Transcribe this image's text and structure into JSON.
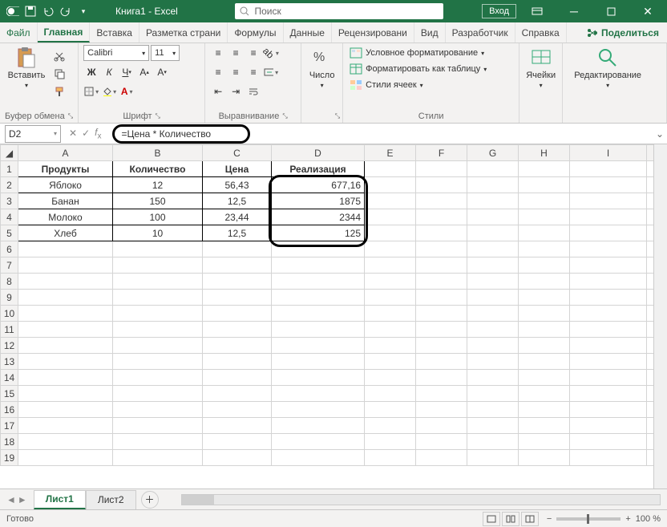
{
  "titlebar": {
    "title": "Книга1 - Excel",
    "search_placeholder": "Поиск",
    "login": "Вход"
  },
  "tabs": {
    "file": "Файл",
    "home": "Главная",
    "insert": "Вставка",
    "layout": "Разметка страни",
    "formulas": "Формулы",
    "data": "Данные",
    "review": "Рецензировани",
    "view": "Вид",
    "developer": "Разработчик",
    "help": "Справка",
    "share": "Поделиться"
  },
  "ribbon": {
    "clipboard": {
      "paste": "Вставить",
      "label": "Буфер обмена"
    },
    "font": {
      "name": "Calibri",
      "size": "11",
      "label": "Шрифт"
    },
    "alignment": {
      "label": "Выравнивание"
    },
    "number": {
      "name": "Число",
      "label": "Число"
    },
    "styles": {
      "cond": "Условное форматирование",
      "table": "Форматировать как таблицу",
      "cell": "Стили ячеек",
      "label": "Стили"
    },
    "cells": {
      "name": "Ячейки",
      "label": "Ячейки"
    },
    "editing": {
      "name": "Редактирование",
      "label": "Редактирование"
    }
  },
  "formula_bar": {
    "cell_ref": "D2",
    "formula": "=Цена * Количество"
  },
  "columns": [
    "A",
    "B",
    "C",
    "D",
    "E",
    "F",
    "G",
    "H",
    "I"
  ],
  "sheet": {
    "headers": {
      "A": "Продукты",
      "B": "Количество",
      "C": "Цена",
      "D": "Реализация"
    },
    "rows": [
      {
        "A": "Яблоко",
        "B": "12",
        "C": "56,43",
        "D": "677,16"
      },
      {
        "A": "Банан",
        "B": "150",
        "C": "12,5",
        "D": "1875"
      },
      {
        "A": "Молоко",
        "B": "100",
        "C": "23,44",
        "D": "2344"
      },
      {
        "A": "Хлеб",
        "B": "10",
        "C": "12,5",
        "D": "125"
      }
    ]
  },
  "sheets": {
    "s1": "Лист1",
    "s2": "Лист2"
  },
  "status": {
    "ready": "Готово",
    "zoom": "100 %"
  }
}
